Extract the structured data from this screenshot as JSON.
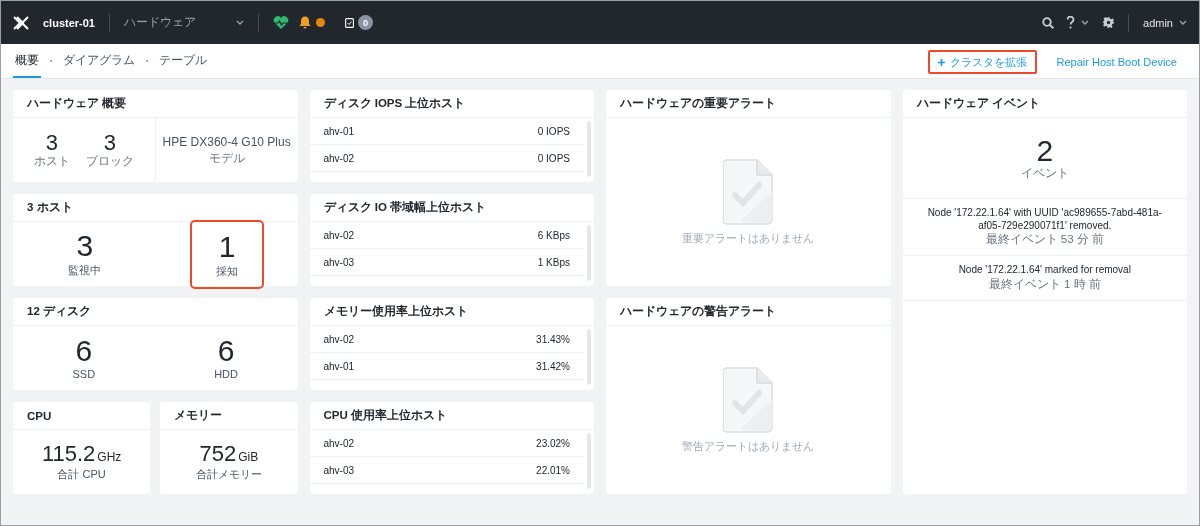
{
  "topbar": {
    "cluster_name": "cluster-01",
    "view_selector": "ハードウェア",
    "task_count": "0",
    "user": "admin"
  },
  "subnav": {
    "tabs": [
      {
        "label": "概要",
        "selected": true
      },
      {
        "label": "ダイアグラム",
        "selected": false
      },
      {
        "label": "テーブル",
        "selected": false
      }
    ],
    "actions": [
      {
        "label": "クラスタを拡張",
        "kind": "add",
        "highlighted": true
      },
      {
        "label": "Repair Host Boot Device",
        "kind": "link",
        "highlighted": false
      }
    ]
  },
  "hardware_summary": {
    "title": "ハードウェア 概要",
    "stats": [
      {
        "value": "3",
        "label": "ホスト"
      },
      {
        "value": "3",
        "label": "ブロック"
      }
    ],
    "model": {
      "value": "HPE DX360-4 G10 Plus",
      "label": "モデル"
    }
  },
  "hosts": {
    "title": "3 ホスト",
    "stats": [
      {
        "value": "3",
        "label": "監視中",
        "highlighted": false
      },
      {
        "value": "1",
        "label": "採知",
        "highlighted": true
      }
    ]
  },
  "disks": {
    "title": "12 ディスク",
    "stats": [
      {
        "value": "6",
        "label": "SSD",
        "highlighted": false
      },
      {
        "value": "6",
        "label": "HDD",
        "highlighted": false
      }
    ]
  },
  "totals": [
    {
      "title": "CPU",
      "value": "115.2",
      "unit": "GHz",
      "label": "合計 CPU"
    },
    {
      "title": "メモリー",
      "value": "752",
      "unit": "GiB",
      "label": "合計メモリー"
    }
  ],
  "top_lists": [
    {
      "title": "ディスク IOPS 上位ホスト",
      "rows": [
        {
          "host": "ahv-01",
          "value": "0 IOPS"
        },
        {
          "host": "ahv-02",
          "value": "0 IOPS"
        }
      ]
    },
    {
      "title": "ディスク IO 帯域幅上位ホスト",
      "rows": [
        {
          "host": "ahv-02",
          "value": "6 KBps"
        },
        {
          "host": "ahv-03",
          "value": "1 KBps"
        }
      ]
    },
    {
      "title": "メモリー使用率上位ホスト",
      "rows": [
        {
          "host": "ahv-02",
          "value": "31.43%"
        },
        {
          "host": "ahv-01",
          "value": "31.42%"
        }
      ]
    },
    {
      "title": "CPU 使用率上位ホスト",
      "rows": [
        {
          "host": "ahv-02",
          "value": "23.02%"
        },
        {
          "host": "ahv-03",
          "value": "22.01%"
        }
      ]
    }
  ],
  "alerts": [
    {
      "title": "ハードウェアの重要アラート",
      "empty_text": "重要アラートはありません"
    },
    {
      "title": "ハードウェアの警告アラート",
      "empty_text": "警告アラートはありません"
    }
  ],
  "events": {
    "title": "ハードウェア イベント",
    "count": "2",
    "count_label": "イベント",
    "items": [
      {
        "text": "Node '172.22.1.64' with UUID 'ac989655-7abd-481a-af05-729e290071f1' removed.",
        "time": "最終イベント 53 分 前"
      },
      {
        "text": "Node '172.22.1.64' marked for removal",
        "time": "最終イベント 1 時 前"
      }
    ]
  }
}
